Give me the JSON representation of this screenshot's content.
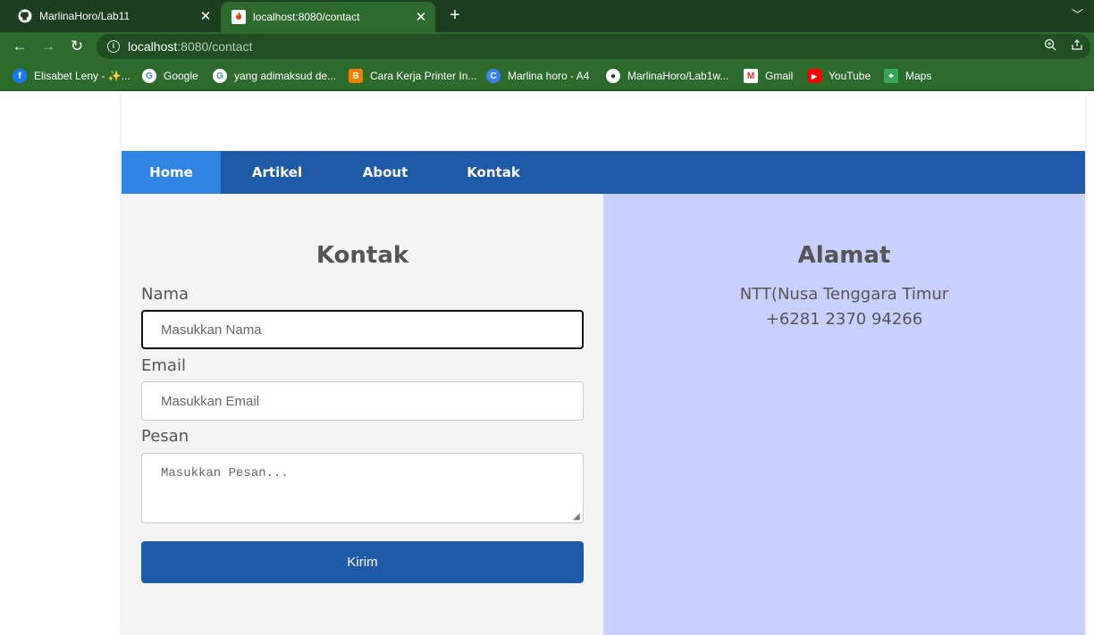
{
  "browser": {
    "tabs": [
      {
        "title": "MarlinaHoro/Lab11",
        "icon": "github-icon",
        "active": false
      },
      {
        "title": "localhost:8080/contact",
        "icon": "codeigniter-icon",
        "active": true
      }
    ],
    "new_tab_label": "+",
    "url_host": "localhost",
    "url_rest": ":8080/contact",
    "bookmarks": [
      {
        "label": "Elisabet Leny - ✨...",
        "icon": "facebook-icon",
        "color": "#1877f2"
      },
      {
        "label": "Google",
        "icon": "google-icon",
        "color": "#ffffff"
      },
      {
        "label": "yang adimaksud de...",
        "icon": "google-icon",
        "color": "#ffffff"
      },
      {
        "label": "Cara Kerja Printer In...",
        "icon": "blogger-icon",
        "color": "#f57d00"
      },
      {
        "label": "Marlina horo - A4",
        "icon": "canva-icon",
        "color": "#3b82f6"
      },
      {
        "label": "MarlinaHoro/Lab1w...",
        "icon": "github-icon",
        "color": "#ffffff"
      },
      {
        "label": "Gmail",
        "icon": "gmail-icon",
        "color": "#ffffff"
      },
      {
        "label": "YouTube",
        "icon": "youtube-icon",
        "color": "#ff0000"
      },
      {
        "label": "Maps",
        "icon": "maps-icon",
        "color": "#34a853"
      }
    ],
    "colors": {
      "tabstrip": "#1c3f1f",
      "toolbar": "#2d6b2d"
    }
  },
  "nav": {
    "items": [
      {
        "label": "Home",
        "active": true
      },
      {
        "label": "Artikel",
        "active": false
      },
      {
        "label": "About",
        "active": false
      },
      {
        "label": "Kontak",
        "active": false
      }
    ]
  },
  "contact_form": {
    "title": "Kontak",
    "name_label": "Nama",
    "name_placeholder": "Masukkan Nama",
    "email_label": "Email",
    "email_placeholder": "Masukkan Email",
    "message_label": "Pesan",
    "message_placeholder": "Masukkan Pesan...",
    "submit_label": "Kirim"
  },
  "address": {
    "title": "Alamat",
    "line1": "NTT(Nusa Tenggara Timur",
    "line2": "+6281 2370 94266"
  },
  "colors": {
    "navbar": "#1f5aa6",
    "nav_active": "#2e84e0",
    "form_bg": "#f4f4f4",
    "aside_bg": "#c7d0fe"
  }
}
